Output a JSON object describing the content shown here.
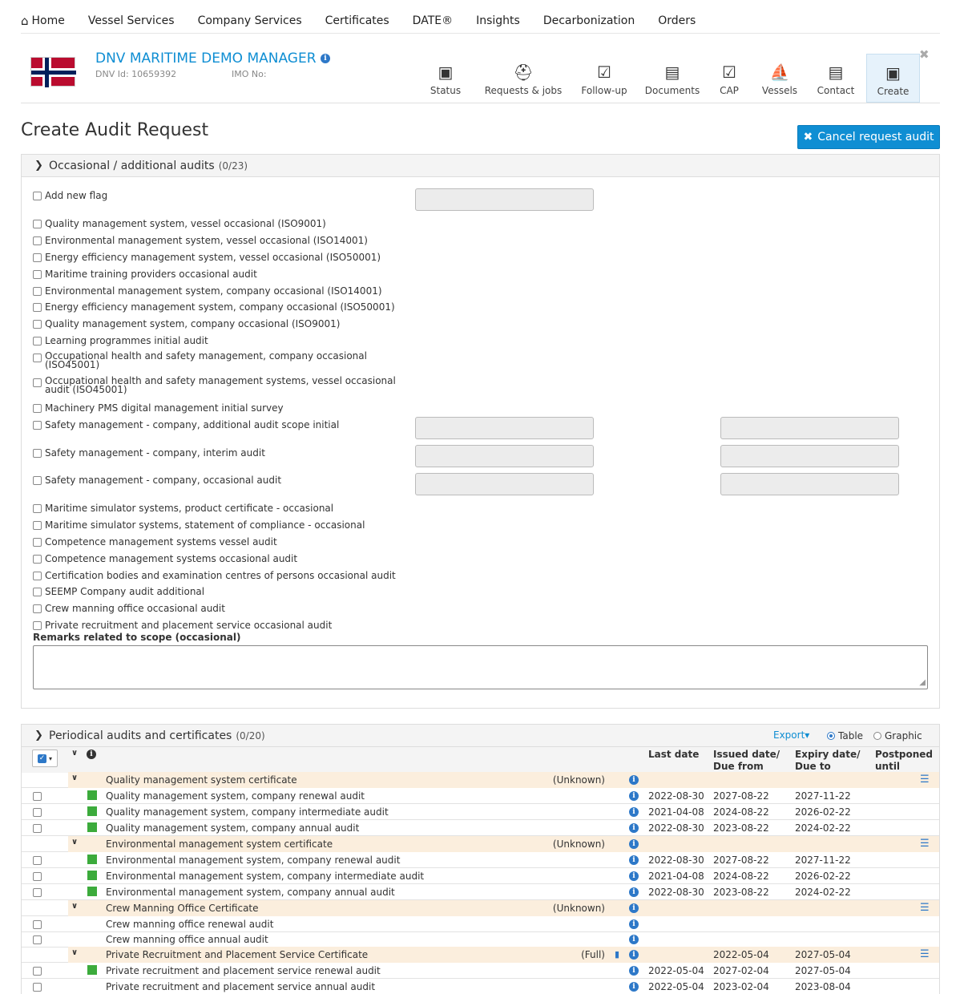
{
  "nav": [
    "Home",
    "Vessel Services",
    "Company Services",
    "Certificates",
    "DATE®",
    "Insights",
    "Decarbonization",
    "Orders"
  ],
  "company": {
    "name": "DNV MARITIME DEMO MANAGER",
    "dnv_id": "DNV Id: 10659392",
    "imo": "IMO No:"
  },
  "tabs": [
    {
      "label": "Status",
      "icon": "status-icon"
    },
    {
      "label": "Requests & jobs",
      "icon": "hardhat-icon"
    },
    {
      "label": "Follow-up",
      "icon": "clipboard-check-icon"
    },
    {
      "label": "Documents",
      "icon": "document-icon"
    },
    {
      "label": "CAP",
      "icon": "cap-clipboard-icon"
    },
    {
      "label": "Vessels",
      "icon": "ship-icon"
    },
    {
      "label": "Contact",
      "icon": "contact-card-icon"
    },
    {
      "label": "Create",
      "icon": "create-icon"
    }
  ],
  "page_title": "Create Audit Request",
  "cancel_label": "Cancel request audit",
  "occasional": {
    "title": "Occasional / additional audits",
    "count": "(0/23)",
    "items": [
      "Add new flag",
      "Quality management system, vessel occasional (ISO9001)",
      "Environmental management system, vessel occasional (ISO14001)",
      "Energy efficiency management system, vessel occasional (ISO50001)",
      "Maritime training providers occasional audit",
      "Environmental management system, company occasional (ISO14001)",
      "Energy efficiency management system, company occasional (ISO50001)",
      "Quality management system, company occasional (ISO9001)",
      "Learning programmes initial audit",
      "Occupational health and safety management, company occasional (ISO45001)",
      "Occupational health and safety management systems, vessel occasional audit (ISO45001)",
      "Machinery PMS digital management initial survey",
      "Safety management - company, additional audit scope initial",
      "Safety management - company, interim audit",
      "Safety management - company, occasional audit",
      "Maritime simulator systems, product certificate - occasional",
      "Maritime simulator systems, statement of compliance - occasional",
      "Competence management systems vessel audit",
      "Competence management systems occasional audit",
      "Certification bodies and examination centres of persons occasional audit",
      "SEEMP Company audit additional",
      "Crew manning office occasional audit",
      "Private recruitment and placement service occasional audit"
    ],
    "remarks_label": "Remarks related to scope (occasional)"
  },
  "periodical": {
    "title": "Periodical audits and certificates",
    "count": "(0/20)",
    "export": "Export",
    "view_table": "Table",
    "view_graphic": "Graphic",
    "view_selected": "Table",
    "headers": {
      "last": "Last date",
      "issued1": "Issued date/",
      "issued2": "Due from",
      "expiry1": "Expiry date/",
      "expiry2": "Due to",
      "postponed1": "Postponed",
      "postponed2": "until"
    },
    "rows": [
      {
        "type": "group",
        "name": "Quality management system certificate",
        "status": "(Unknown)",
        "last": "",
        "issued": "",
        "expiry": ""
      },
      {
        "type": "item",
        "name": "Quality management system, company renewal audit",
        "green": true,
        "last": "2022-08-30",
        "issued": "2027-08-22",
        "expiry": "2027-11-22"
      },
      {
        "type": "item",
        "name": "Quality management system, company intermediate audit",
        "green": true,
        "last": "2021-04-08",
        "issued": "2024-08-22",
        "expiry": "2026-02-22"
      },
      {
        "type": "item",
        "name": "Quality management system, company annual audit",
        "green": true,
        "last": "2022-08-30",
        "issued": "2023-08-22",
        "expiry": "2024-02-22"
      },
      {
        "type": "group",
        "name": "Environmental management system certificate",
        "status": "(Unknown)",
        "last": "",
        "issued": "",
        "expiry": ""
      },
      {
        "type": "item",
        "name": "Environmental management system, company renewal audit",
        "green": true,
        "last": "2022-08-30",
        "issued": "2027-08-22",
        "expiry": "2027-11-22"
      },
      {
        "type": "item",
        "name": "Environmental management system, company intermediate audit",
        "green": true,
        "last": "2021-04-08",
        "issued": "2024-08-22",
        "expiry": "2026-02-22"
      },
      {
        "type": "item",
        "name": "Environmental management system, company annual audit",
        "green": true,
        "last": "2022-08-30",
        "issued": "2023-08-22",
        "expiry": "2024-02-22"
      },
      {
        "type": "group",
        "name": "Crew Manning Office Certificate",
        "status": "(Unknown)",
        "last": "",
        "issued": "",
        "expiry": ""
      },
      {
        "type": "item",
        "name": "Crew manning office renewal audit",
        "green": false,
        "last": "",
        "issued": "",
        "expiry": ""
      },
      {
        "type": "item",
        "name": "Crew manning office annual audit",
        "green": false,
        "last": "",
        "issued": "",
        "expiry": ""
      },
      {
        "type": "group",
        "name": "Private Recruitment and Placement Service Certificate",
        "status": "(Full)",
        "doc": true,
        "last": "",
        "issued": "2022-05-04",
        "expiry": "2027-05-04"
      },
      {
        "type": "item",
        "name": "Private recruitment and placement service renewal audit",
        "green": true,
        "last": "2022-05-04",
        "issued": "2027-02-04",
        "expiry": "2027-05-04"
      },
      {
        "type": "item",
        "name": "Private recruitment and placement service annual audit",
        "green": false,
        "last": "2022-05-04",
        "issued": "2023-02-04",
        "expiry": "2023-08-04"
      }
    ]
  },
  "colors": {
    "accent": "#0f8ed3",
    "group_bg": "#fbeedd",
    "status_green": "#3cab3c",
    "info_blue": "#2d78c8"
  }
}
